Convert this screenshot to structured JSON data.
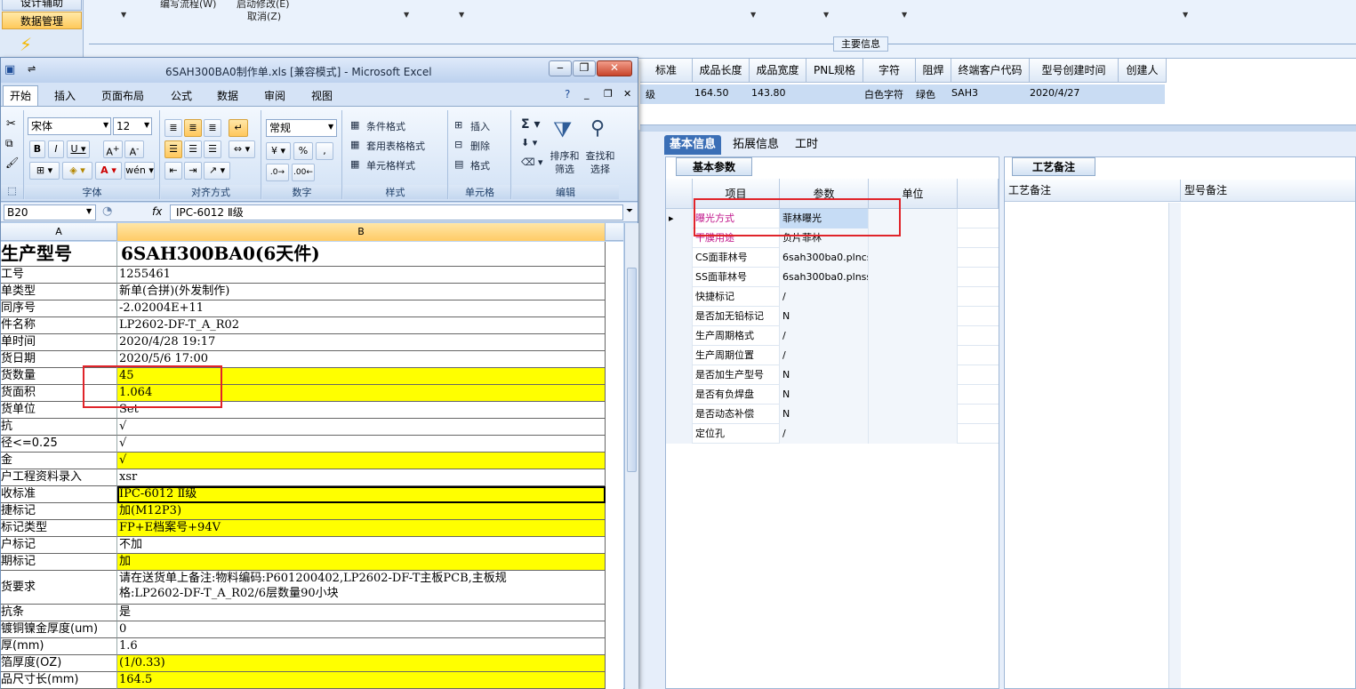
{
  "nav": {
    "item_top": "设计辅助",
    "item_data": "数据管理"
  },
  "top_menu": {
    "item1": "编写流程(W)",
    "item2": "启动修改(E)",
    "cancel": "取消(Z)"
  },
  "main_info": "主要信息",
  "grid": {
    "headers": [
      "标准",
      "成品长度",
      "成品宽度",
      "PNL规格",
      "字符",
      "阻焊",
      "终端客户代码",
      "型号创建时间",
      "创建人"
    ],
    "row": {
      "grade": "级",
      "length": "164.50",
      "width": "143.80",
      "char": "白色字符",
      "mask": "绿色",
      "customer": "SAH3",
      "created": "2020/4/27"
    }
  },
  "right_tabs": [
    "基本信息",
    "拓展信息",
    "工时"
  ],
  "basic_params": {
    "tab": "基本参数",
    "headers": [
      "项目",
      "参数",
      "单位"
    ],
    "rows": [
      {
        "item": "曝光方式",
        "value": "菲林曝光"
      },
      {
        "item": "干膜用途",
        "value": "负片菲林"
      },
      {
        "item": "CS面菲林号",
        "value": "6sah300ba0.plncs"
      },
      {
        "item": "SS面菲林号",
        "value": "6sah300ba0.plnss"
      },
      {
        "item": "快捷标记",
        "value": "/"
      },
      {
        "item": "是否加无铅标记",
        "value": "N"
      },
      {
        "item": "生产周期格式",
        "value": "/"
      },
      {
        "item": "生产周期位置",
        "value": "/"
      },
      {
        "item": "是否加生产型号",
        "value": "N"
      },
      {
        "item": "是否有负焊盘",
        "value": "N"
      },
      {
        "item": "是否动态补偿",
        "value": "N"
      },
      {
        "item": "定位孔",
        "value": "/"
      }
    ]
  },
  "process_notes": {
    "tab": "工艺备注",
    "col1": "工艺备注",
    "col2": "型号备注"
  },
  "excel": {
    "title": "6SAH300BA0制作单.xls [兼容模式] - Microsoft Excel",
    "tabs": [
      "开始",
      "插入",
      "页面布局",
      "公式",
      "数据",
      "审阅",
      "视图"
    ],
    "font_name": "宋体",
    "font_size": "12",
    "number_format": "常规",
    "styles": [
      "条件格式",
      "套用表格格式",
      "单元格样式"
    ],
    "cells_ops": [
      "插入",
      "删除",
      "格式"
    ],
    "sort_filter": "排序和筛选",
    "find_select": "查找和选择",
    "groups": [
      "字体",
      "对齐方式",
      "数字",
      "样式",
      "单元格",
      "编辑"
    ],
    "name_box": "B20",
    "formula": "IPC-6012 Ⅱ级",
    "col_a": "A",
    "col_b": "B",
    "rows": [
      {
        "a": "生产型号",
        "b": "6SAH300BA0(6天件)",
        "y": false
      },
      {
        "a": "工号",
        "b": "1255461",
        "y": false
      },
      {
        "a": "单类型",
        "b": "新单(合拼)(外发制作)",
        "y": false
      },
      {
        "a": "同序号",
        "b": "-2.02004E+11",
        "y": false
      },
      {
        "a": "件名称",
        "b": "LP2602-DF-T_A_R02",
        "y": false
      },
      {
        "a": "单时间",
        "b": "2020/4/28 19:17",
        "y": false
      },
      {
        "a": "货日期",
        "b": "2020/5/6 17:00",
        "y": false
      },
      {
        "a": "货数量",
        "b": "45",
        "y": true
      },
      {
        "a": "货面积",
        "b": "1.064",
        "y": true
      },
      {
        "a": "货单位",
        "b": "Set",
        "y": false
      },
      {
        "a": "抗",
        "b": "√",
        "y": false
      },
      {
        "a": "径<=0.25",
        "b": "√",
        "y": false
      },
      {
        "a": "金",
        "b": "√",
        "y": true
      },
      {
        "a": "户工程资料录入",
        "b": "xsr",
        "y": false
      },
      {
        "a": "收标准",
        "b": "IPC-6012 Ⅱ级",
        "y": true
      },
      {
        "a": "捷标记",
        "b": "加(M12P3)",
        "y": true
      },
      {
        "a": "标记类型",
        "b": "FP+E档案号+94V",
        "y": true
      },
      {
        "a": "户标记",
        "b": "不加",
        "y": false
      },
      {
        "a": "期标记",
        "b": "加",
        "y": true
      },
      {
        "a": "货要求",
        "b": "请在送货单上备注:物料编码:P601200402,LP2602-DF-T主板PCB,主板规",
        "b2": "格:LP2602-DF-T_A_R02/6层数量90小块",
        "y": false,
        "tall": true
      },
      {
        "a": "抗条",
        "b": "是",
        "y": false
      },
      {
        "a": "镀铜镍金厚度(um)",
        "b": "0",
        "y": false
      },
      {
        "a": "厚(mm)",
        "b": "1.6",
        "y": false
      },
      {
        "a": "箔厚度(OZ)",
        "b": "(1/0.33)",
        "y": true
      },
      {
        "a": "品尺寸长(mm)",
        "b": "164.5",
        "y": true
      }
    ]
  }
}
